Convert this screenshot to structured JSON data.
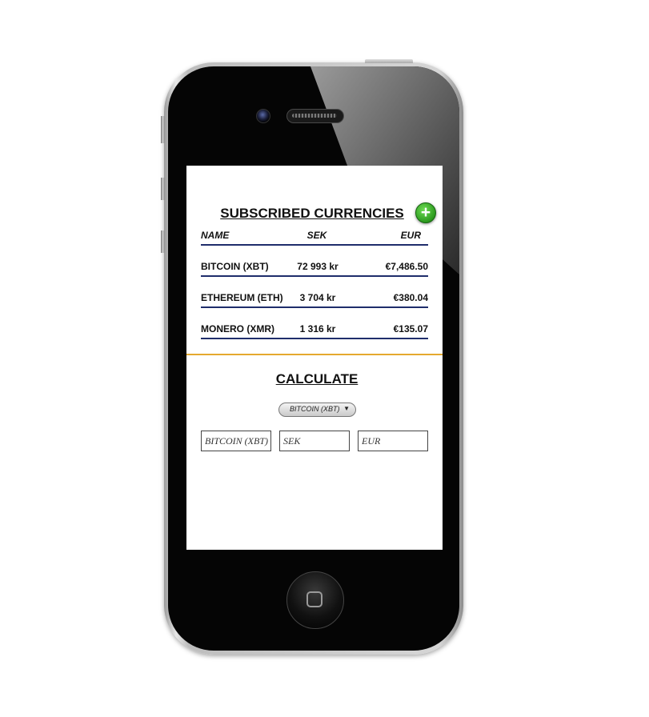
{
  "subscribed": {
    "title": "SUBSCRIBED CURRENCIES",
    "add_label": "+",
    "headers": {
      "name": "NAME",
      "sek": "SEK",
      "eur": "EUR"
    },
    "rows": [
      {
        "name": "BITCOIN (XBT)",
        "sek": "72 993 kr",
        "eur": "€7,486.50"
      },
      {
        "name": "ETHEREUM (ETH)",
        "sek": "3 704 kr",
        "eur": "€380.04"
      },
      {
        "name": "MONERO (XMR)",
        "sek": "1 316 kr",
        "eur": "€135.07"
      }
    ]
  },
  "calculate": {
    "title": "CALCULATE",
    "selected_currency": "BITCOIN (XBT)",
    "arrow": "▼",
    "inputs": {
      "crypto_placeholder": "BITCOIN (XBT)",
      "sek_placeholder": "SEK",
      "eur_placeholder": "EUR"
    }
  },
  "colors": {
    "row_border": "#1f2d6b",
    "divider": "#e5a92e",
    "add_button": "#2c9a1e"
  }
}
